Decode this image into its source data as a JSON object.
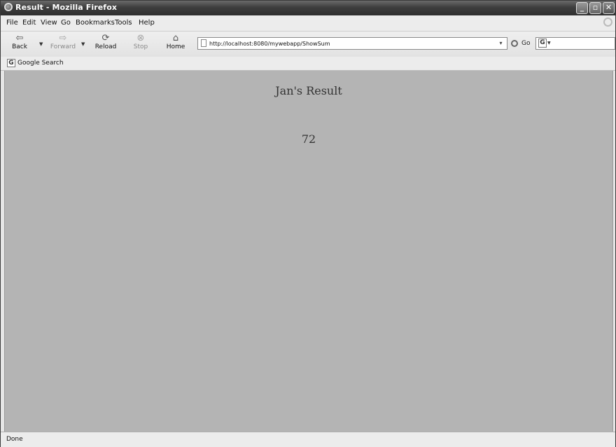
{
  "window": {
    "title": "Result - Mozilla Firefox"
  },
  "menu": [
    "File",
    "Edit",
    "View",
    "Go",
    "Bookmarks",
    "Tools",
    "Help"
  ],
  "toolbar": {
    "back": "Back",
    "forward": "Forward",
    "reload": "Reload",
    "stop": "Stop",
    "home": "Home",
    "go": "Go"
  },
  "address": {
    "url": "http://localhost:8080/mywebapp/ShowSum"
  },
  "bookmarks": {
    "google_search": "Google Search"
  },
  "page": {
    "heading": "Jan's Result",
    "value": "72"
  },
  "status": {
    "text": "Done"
  },
  "icons": {
    "back": "back-arrow-icon",
    "forward": "forward-arrow-icon",
    "reload": "reload-icon",
    "stop": "stop-icon",
    "home": "home-icon"
  }
}
